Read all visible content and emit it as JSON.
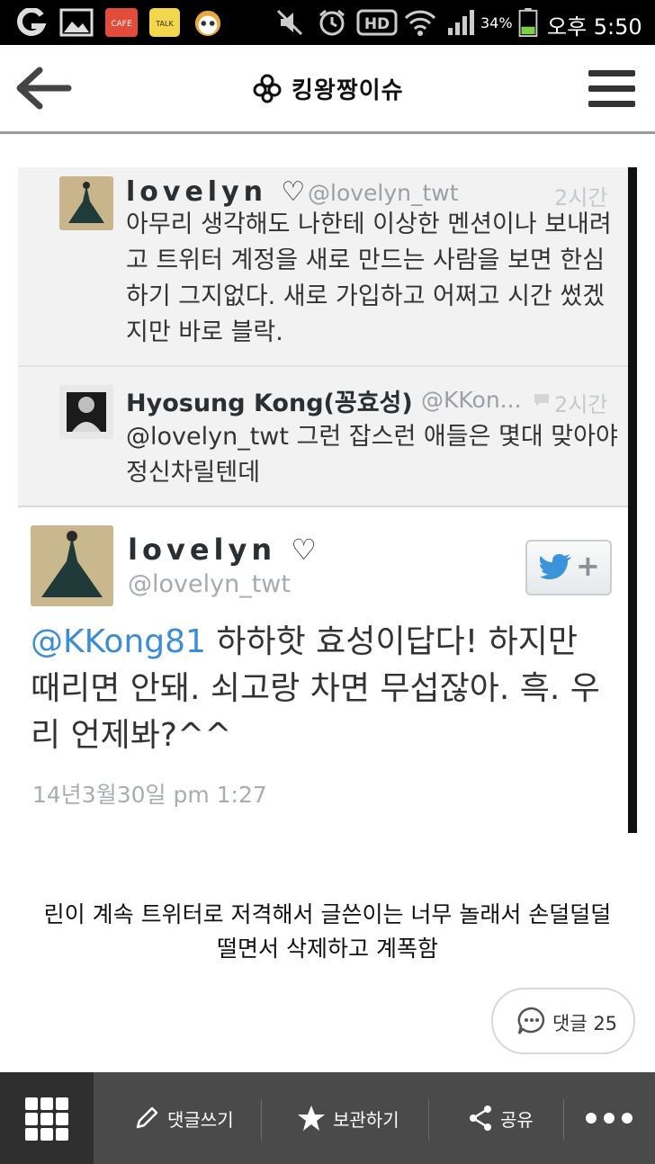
{
  "status_bar": {
    "battery": "34%",
    "time": "오후 5:50",
    "icons": [
      "g-icon",
      "gallery-icon",
      "cafe-icon",
      "talk-icon",
      "pororo-icon",
      "mute-icon",
      "alarm-icon",
      "hd-icon",
      "wifi-icon",
      "signal-icon",
      "battery-icon"
    ],
    "cafe_label": "CAFE",
    "talk_label": "TALK",
    "hd_label": "HD"
  },
  "header": {
    "brand": "킹왕짱이슈"
  },
  "tweet_screenshot": {
    "replies": [
      {
        "name": "lovelyn ♡",
        "handle": "@lovelyn_twt",
        "time": "2시간",
        "text": "아무리 생각해도 나한테 이상한 멘션이나 보내려고 트위터 계정을 새로 만드는 사람을 보면 한심하기 그지없다. 새로 가입하고 어쩌고 시간 썼겠지만 바로 블락."
      },
      {
        "name": "Hyosung Kong(꽁효성)",
        "handle": "@KKon...",
        "time": "2시간",
        "text": "@lovelyn_twt 그런 잡스런 애들은 몇대 맞아야 정신차릴텐데"
      }
    ],
    "main_tweet": {
      "name": "lovelyn ♡",
      "handle": "@lovelyn_twt",
      "mention": "@KKong81",
      "text": " 하하핫 효성이답다! 하지만 때리면 안돼. 쇠고랑 차면 무섭잖아. 흑. 우리 언제봐?^^",
      "date": "14년3월30일 pm 1:27",
      "follow_plus": "+"
    }
  },
  "caption": {
    "line1": "린이 계속 트위터로 저격해서 글쓴이는 너무 놀래서 손덜덜덜",
    "line2": "떨면서 삭제하고 계폭함"
  },
  "comments": {
    "label": "댓글 25"
  },
  "bottom_bar": {
    "write_comment": "댓글쓰기",
    "save": "보관하기",
    "share": "공유"
  }
}
